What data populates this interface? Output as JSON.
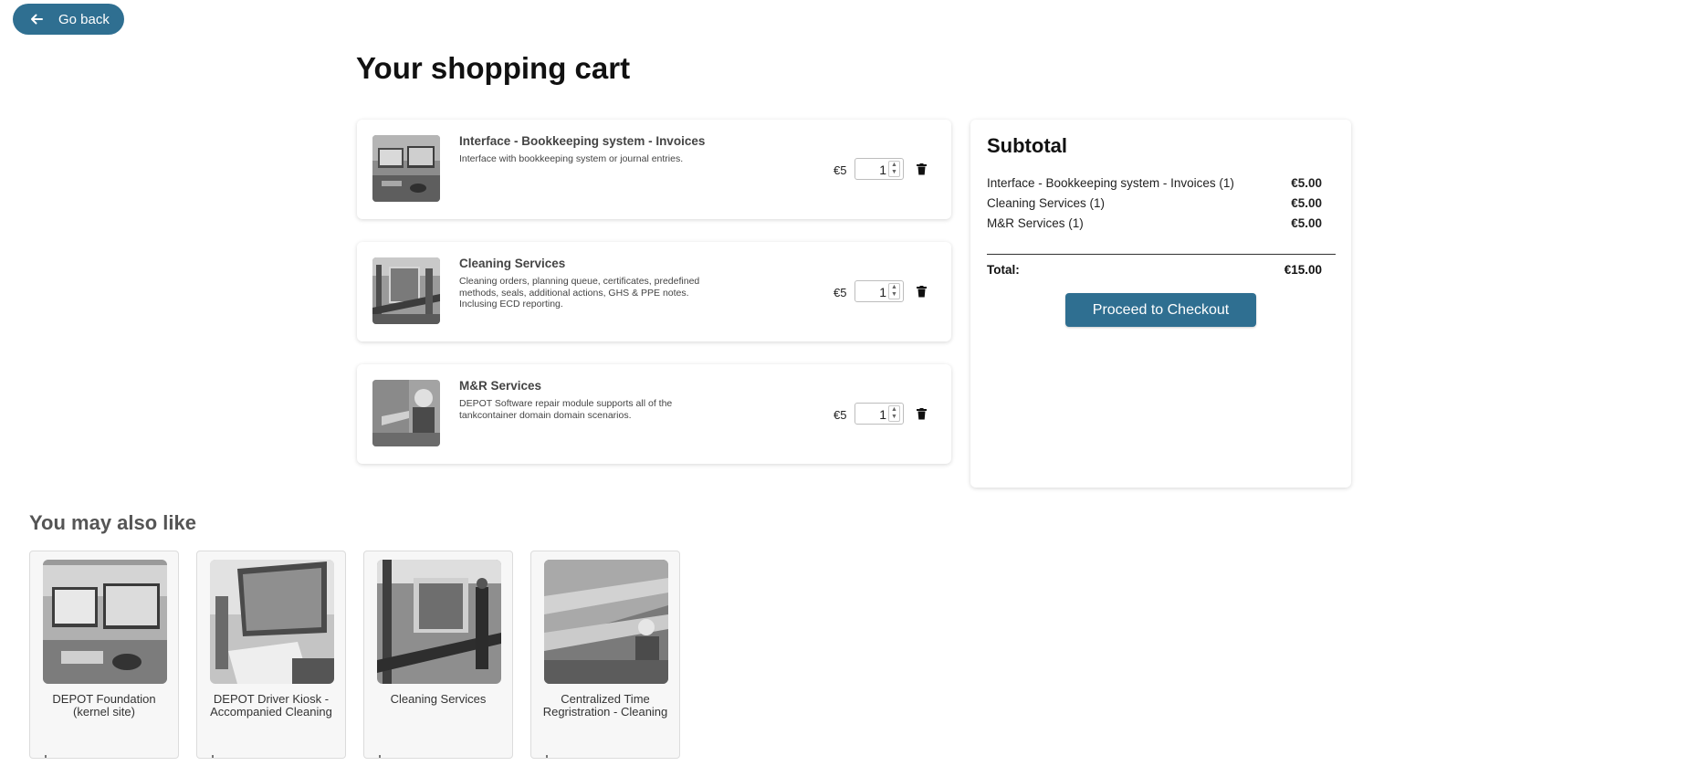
{
  "header": {
    "back_label": "Go back"
  },
  "page": {
    "title": "Your shopping cart"
  },
  "cart": {
    "currency_symbol": "€5",
    "items": [
      {
        "name": "Interface - Bookkeeping system - Invoices",
        "description": "Interface with bookkeeping system or journal entries.",
        "price": "€5",
        "quantity": "1"
      },
      {
        "name": "Cleaning Services",
        "description": "Cleaning orders, planning queue, certificates, predefined methods, seals, additional actions, GHS & PPE notes. Inclusing ECD reporting.",
        "price": "€5",
        "quantity": "1"
      },
      {
        "name": "M&R Services",
        "description": "DEPOT Software repair module supports all of the tankcontainer domain domain scenarios.",
        "price": "€5",
        "quantity": "1"
      }
    ]
  },
  "subtotal": {
    "title": "Subtotal",
    "lines": [
      {
        "label": "Interface - Bookkeeping system - Invoices (1)",
        "amount": "€5.00"
      },
      {
        "label": "Cleaning Services (1)",
        "amount": "€5.00"
      },
      {
        "label": "M&R Services (1)",
        "amount": "€5.00"
      }
    ],
    "total_label": "Total:",
    "total_amount": "€15.00",
    "checkout_label": "Proceed to Checkout"
  },
  "recommendations": {
    "title": "You may also like",
    "items": [
      {
        "name": "DEPOT Foundation (kernel site)"
      },
      {
        "name": "DEPOT Driver Kiosk - Accompanied Cleaning"
      },
      {
        "name": "Cleaning Services"
      },
      {
        "name": "Centralized Time Regristration - Cleaning"
      }
    ]
  },
  "colors": {
    "accent": "#2f6f91",
    "card_bg": "#ffffff",
    "rec_bg": "#f7f7f7"
  }
}
